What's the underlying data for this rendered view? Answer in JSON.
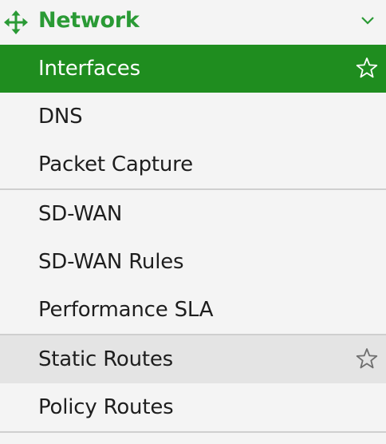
{
  "section": {
    "title": "Network",
    "icon": "move-arrows-icon",
    "expand_icon": "chevron-down-icon"
  },
  "groups": [
    [
      {
        "label": "Interfaces",
        "state": "active",
        "favorite_icon": "star-icon"
      },
      {
        "label": "DNS"
      },
      {
        "label": "Packet Capture"
      }
    ],
    [
      {
        "label": "SD-WAN"
      },
      {
        "label": "SD-WAN Rules"
      },
      {
        "label": "Performance SLA"
      }
    ],
    [
      {
        "label": "Static Routes",
        "state": "hover",
        "favorite_icon": "star-icon"
      },
      {
        "label": "Policy Routes"
      }
    ]
  ],
  "colors": {
    "accent": "#2a9a35",
    "active_background": "#1f8d1f",
    "hover_background": "#e4e4e4",
    "background": "#f4f4f4"
  }
}
